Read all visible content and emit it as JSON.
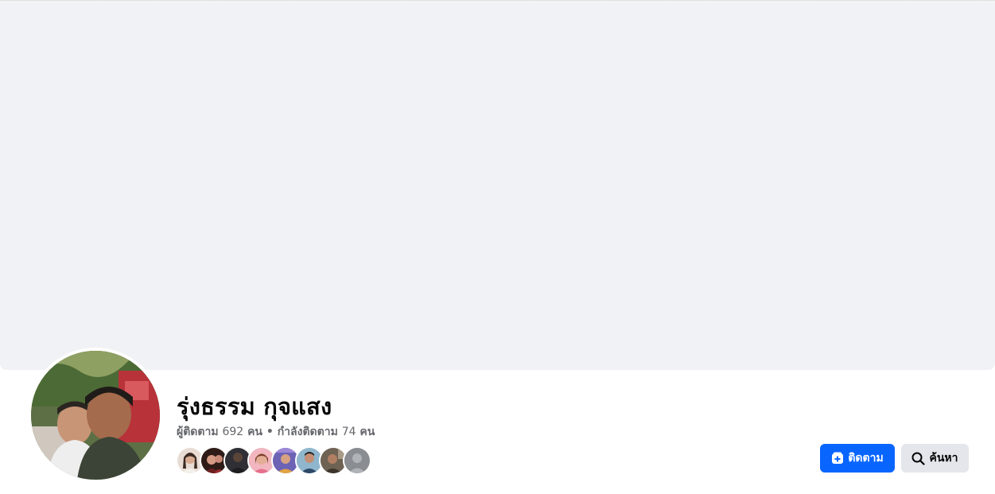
{
  "profile": {
    "name": "รุ่งธรรม กุจแสง",
    "followers_label": "ผู้ติดตาม",
    "followers_count": "692",
    "followers_unit": "คน",
    "separator": "•",
    "following_label": "กำลังติดตาม",
    "following_count": "74",
    "following_unit": "คน"
  },
  "friend_avatars": [
    {
      "icon": "friend-photo",
      "color": "#c9a99a"
    },
    {
      "icon": "friend-photo",
      "color": "#5a2a22"
    },
    {
      "icon": "friend-photo",
      "color": "#3a3a3a"
    },
    {
      "icon": "friend-photo",
      "color": "#d98a9a"
    },
    {
      "icon": "friend-photo",
      "color": "#7a6fb8"
    },
    {
      "icon": "friend-photo",
      "color": "#4a7a9a"
    },
    {
      "icon": "friend-photo",
      "color": "#5a4a3a"
    },
    {
      "icon": "default-avatar",
      "color": "#8a8d91"
    }
  ],
  "actions": {
    "follow_label": "ติดตาม",
    "follow_icon": "follow-plus-icon",
    "search_label": "ค้นหา",
    "search_icon": "magnifier-icon"
  },
  "colors": {
    "primary": "#0866ff",
    "cover_bg": "#f0f2f5",
    "secondary_button": "#e4e6eb",
    "secondary_text": "#65676b"
  }
}
